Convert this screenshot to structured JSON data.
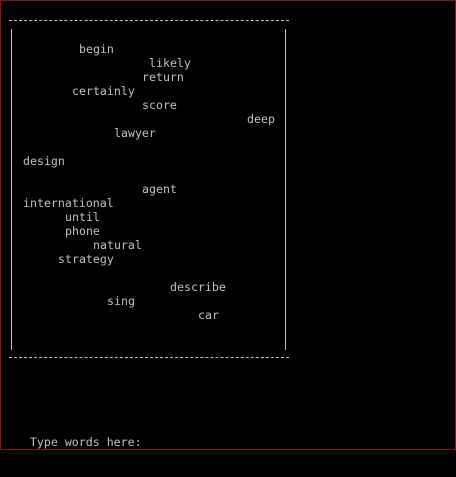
{
  "game": {
    "words": [
      {
        "text": "begin"
      },
      {
        "text": "likely"
      },
      {
        "text": "return"
      },
      {
        "text": "certainly"
      },
      {
        "text": "score"
      },
      {
        "text": "deep"
      },
      {
        "text": "lawyer"
      },
      {
        "text": "design"
      },
      {
        "text": "agent"
      },
      {
        "text": "international"
      },
      {
        "text": "until"
      },
      {
        "text": "phone"
      },
      {
        "text": "natural"
      },
      {
        "text": "strategy"
      },
      {
        "text": "describe"
      },
      {
        "text": "sing"
      },
      {
        "text": "car"
      }
    ]
  },
  "prompt": {
    "label": "Type words here:",
    "value": ""
  },
  "colors": {
    "background": "#000000",
    "text": "#c0c0c0",
    "window_border": "#7a1a1a"
  }
}
